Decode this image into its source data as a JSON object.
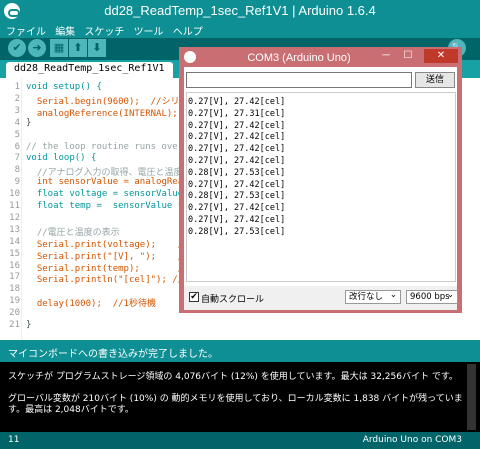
{
  "window": {
    "title": "dd28_ReadTemp_1sec_Ref1V1 | Arduino 1.6.4"
  },
  "menu": [
    "ファイル",
    "編集",
    "スケッチ",
    "ツール",
    "ヘルプ"
  ],
  "toolbar": {
    "verify": "✔",
    "upload": "➜",
    "new": "▦",
    "open": "⬆",
    "save": "⬇",
    "monitor": "🔍"
  },
  "tab": {
    "label": "dd28_ReadTemp_1sec_Ref1V1"
  },
  "editor": {
    "line_numbers": [
      "1",
      "2",
      "3",
      "4",
      "5",
      "6",
      "7",
      "8",
      "9",
      "10",
      "11",
      "12",
      "13",
      "14",
      "15",
      "16",
      "17",
      "18",
      "19",
      "20",
      "21"
    ],
    "lines": [
      "void setup() {",
      "  Serial.begin(9600);  //シリアル通信",
      "  analogReference(INTERNAL);  //アナロ",
      "}",
      "",
      "// the loop routine runs over and over",
      "void loop() {",
      "  //アナログ入力の取得、電圧と温度の計",
      "  int sensorValue = analogRead(A0);",
      "  float voltage = sensorValue * (1.1",
      "  float temp =  sensorValue * (110.0",
      "",
      "  //電圧と温度の表示",
      "  Serial.print(voltage);    //電圧の表",
      "  Serial.print(\"[V], \");    //電圧単位",
      "  Serial.print(temp);       //温度の表",
      "  Serial.println(\"[cel]\"); //温度単位",
      "",
      "  delay(1000);  //1秒待機",
      "",
      "}"
    ]
  },
  "status": {
    "message": "マイコンボードへの書き込みが完了しました。"
  },
  "console": {
    "lines": [
      "スケッチが プログラムストレージ領域の 4,076バイト (12%) を使用しています。最大は 32,256バイト です。",
      "グローバル変数が 210バイト (10%) の 動的メモリを使用しており、ローカル変数に 1,838 バイトが残っています。最高は 2,048バイトです。"
    ]
  },
  "footer": {
    "line": "11",
    "board": "Arduino Uno on COM3"
  },
  "serial": {
    "title": "COM3 (Arduino Uno)",
    "send_label": "送信",
    "output": [
      "0.27[V], 27.42[cel]",
      "0.27[V], 27.31[cel]",
      "0.27[V], 27.42[cel]",
      "0.27[V], 27.42[cel]",
      "0.27[V], 27.42[cel]",
      "0.27[V], 27.42[cel]",
      "0.28[V], 27.53[cel]",
      "0.27[V], 27.42[cel]",
      "0.28[V], 27.53[cel]",
      "0.27[V], 27.42[cel]",
      "0.27[V], 27.42[cel]",
      "0.28[V], 27.53[cel]"
    ],
    "autoscroll_label": "自動スクロール",
    "autoscroll_checked": "✔",
    "line_ending": "改行なし",
    "baud": "9600 bps"
  }
}
